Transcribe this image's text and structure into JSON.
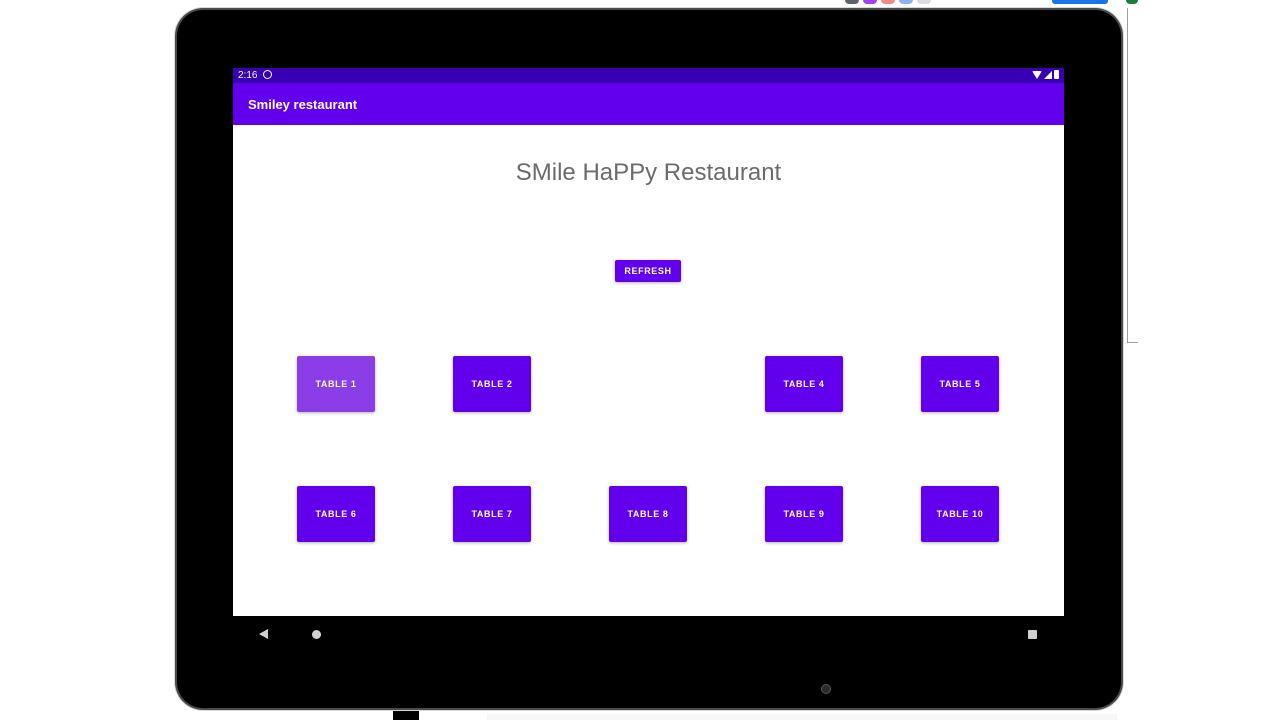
{
  "status_bar": {
    "time": "2:16"
  },
  "app_bar": {
    "title": "Smiley restaurant"
  },
  "main": {
    "heading": "SMile HaPPy Restaurant",
    "refresh_label": "REFRESH",
    "tables": [
      {
        "label": "TABLE 1",
        "state": "pressed"
      },
      {
        "label": "TABLE 2",
        "state": "normal"
      },
      {
        "label": "TABLE 4",
        "state": "normal"
      },
      {
        "label": "TABLE 5",
        "state": "normal"
      },
      {
        "label": "TABLE 6",
        "state": "normal"
      },
      {
        "label": "TABLE 7",
        "state": "normal"
      },
      {
        "label": "TABLE 8",
        "state": "normal"
      },
      {
        "label": "TABLE 9",
        "state": "normal"
      },
      {
        "label": "TABLE 10",
        "state": "normal"
      }
    ]
  },
  "nav_bar": {
    "icons": [
      "back-icon",
      "home-icon",
      "recents-icon"
    ]
  },
  "colors": {
    "primary": "#6200ee",
    "primary_dark": "#3700b3",
    "pressed": "#8b3de8",
    "heading_text": "#6b6b6b"
  }
}
